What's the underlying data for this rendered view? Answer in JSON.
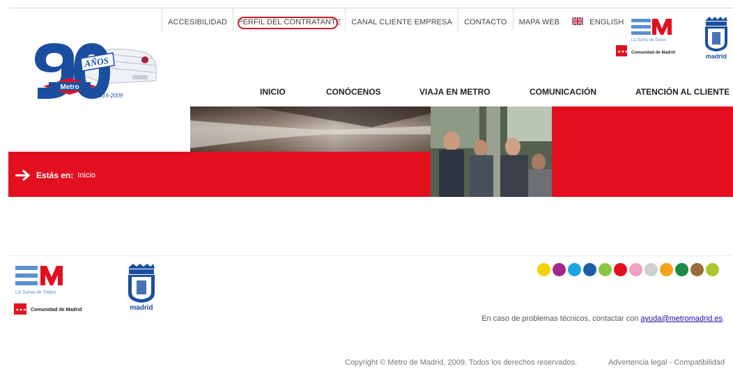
{
  "utility_nav": {
    "items": [
      "ACCESIBILIDAD",
      "PERFIL DEL CONTRATANTE",
      "CANAL CLIENTE EMPRESA",
      "CONTACTO",
      "MAPA WEB",
      "ENGLISH"
    ],
    "language_icon": "uk-flag-icon",
    "highlight_color": "#d11a2a"
  },
  "logos": {
    "metro_badge_text": "Metro",
    "metro_years": "1919-2009",
    "metro_anos": "AÑOS",
    "cm_tagline": "La Suma de Todos",
    "cm_name": "Comunidad de Madrid",
    "madrid_name": "madrid"
  },
  "main_nav": {
    "items": [
      "INICIO",
      "CONÓCENOS",
      "VIAJA EN METRO",
      "COMUNICACIÓN",
      "ATENCIÓN AL CLIENTE"
    ]
  },
  "breadcrumb": {
    "label": "Estás en:",
    "current": "Inicio"
  },
  "footer": {
    "line_colors": [
      "#f6d400",
      "#a0288c",
      "#1aa7e0",
      "#1c5fa8",
      "#8cc63f",
      "#e2101f",
      "#f2a0c4",
      "#cfcfcf",
      "#f7a11a",
      "#1b8a44",
      "#9a6b3a",
      "#a6c72e"
    ],
    "contact_text": "En caso de problemas técnicos, contactar con",
    "contact_email": "ayuda@metromadrid.es",
    "contact_end": ".",
    "copyright": "Copyright © Metro de Madrid, 2009. Todos los derechos reservados.",
    "legal": "Advertencia legal - Compatibilidad"
  },
  "colors": {
    "brand_red": "#e2101f",
    "metro_blue": "#1a4fa0"
  }
}
